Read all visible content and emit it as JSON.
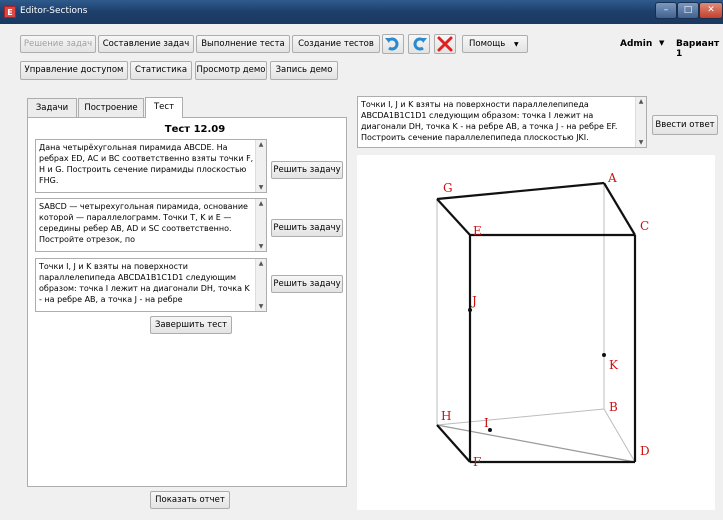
{
  "window": {
    "title": "Editor-Sections",
    "app_icon_letter": "E",
    "controls": {
      "minimize": "–",
      "maximize": "□",
      "close": "✕"
    }
  },
  "toolbar1": {
    "solve_tasks": "Решение задач",
    "compose_tasks": "Составление задач",
    "run_test": "Выполнение теста",
    "create_tests": "Создание тестов",
    "help": "Помощь",
    "user": "Admin",
    "variant": "Вариант 1"
  },
  "toolbar2": {
    "access_control": "Управление доступом",
    "statistics": "Статистика",
    "view_demo": "Просмотр демо",
    "record_demo": "Запись демо"
  },
  "tabs": {
    "tasks": "Задачи",
    "construction": "Построение",
    "test": "Тест"
  },
  "test": {
    "title": "Тест 12.09",
    "tasks": [
      {
        "text": "Дана четырёхугольная пирамида ABCDE. На ребрах ED, AC и BC соответственно взяты точки F, H и G. Построить сечение пирамиды плоскостью FHG.",
        "button": "Решить задачу"
      },
      {
        "text": "SABCD — четырехугольная пирамида, основание которой — параллелограмм. Точки T, K и E — середины ребер AB, AD и SC соответственно. Постройте отрезок, по",
        "button": "Решить задачу"
      },
      {
        "text": "Точки I, J и K взяты на поверхности параллелепипеда ABCDA1B1C1D1 следующим образом: точка I лежит на диагонали DH, точка K - на ребре AB, а точка J - на ребре",
        "button": "Решить задачу"
      }
    ],
    "finish": "Завершить тест",
    "show_report": "Показать отчет"
  },
  "answer": {
    "text": "Точки I, J и K взяты на поверхности параллелепипеда ABCDA1B1C1D1 следующим образом: точка I лежит на диагонали DH, точка K - на ребре AB, а точка J - на ребре EF. Построить сечение параллелепипеда плоскостью JKI.",
    "button": "Ввести ответ"
  },
  "figure": {
    "labels": {
      "A": "A",
      "B": "B",
      "C": "C",
      "D": "D",
      "E": "E",
      "F": "F",
      "G": "G",
      "H": "H",
      "I": "I",
      "J": "J",
      "K": "K"
    },
    "label_color": "#cc1111"
  },
  "icons": [
    "undo-icon",
    "redo-icon",
    "delete-icon",
    "dropdown-arrow-icon"
  ]
}
